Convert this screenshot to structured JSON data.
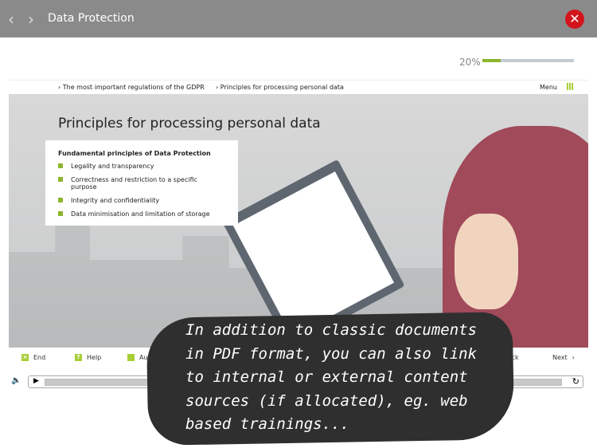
{
  "topbar": {
    "title": "Data Protection",
    "back_icon": "chevron-left",
    "forward_icon": "chevron-right",
    "close_icon": "close-x",
    "close_color": "#d4141c"
  },
  "progress": {
    "label": "20%",
    "value_percent": 20,
    "color": "#8cb52e"
  },
  "breadcrumb": {
    "items": [
      "The most important regulations of the GDPR",
      "Principles for processing personal data"
    ],
    "menu_label": "Menu"
  },
  "slide": {
    "title": "Principles for processing personal data",
    "box_title": "Fundamental principles of Data Protection",
    "bullets": [
      "Legality and transparency",
      "Correctness and restriction to a specific purpose",
      "Integrity and confidentiality",
      "Data minimisation and limitation of storage"
    ]
  },
  "controls": {
    "end": "End",
    "help": "Help",
    "audio_text": "Audio text",
    "back": "Back",
    "next": "Next"
  },
  "callout": {
    "text": "In addition to classic documents in PDF format, you can also link to internal or external content sources (if allocated), eg. web based trainings..."
  }
}
